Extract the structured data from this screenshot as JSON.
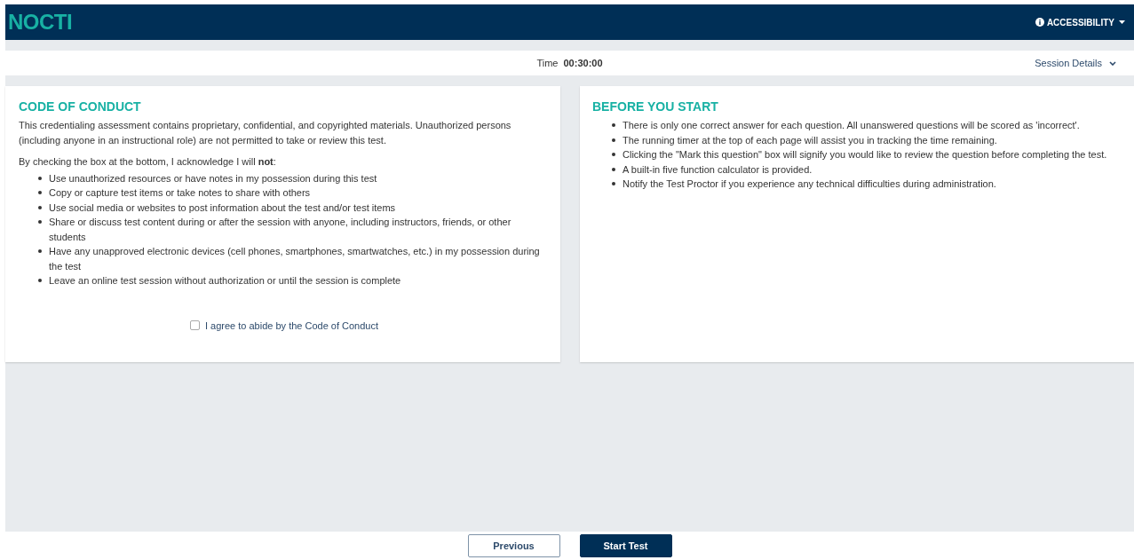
{
  "header": {
    "logo": "NOCTI",
    "accessibility": "ACCESSIBILITY"
  },
  "time_bar": {
    "label": "Time",
    "value": "00:30:00",
    "session_details": "Session Details"
  },
  "code_of_conduct": {
    "title": "CODE OF CONDUCT",
    "intro": "This credentialing assessment contains proprietary, confidential, and copyrighted materials. Unauthorized persons (including anyone in an instructional role) are not permitted to take or review this test.",
    "lead": "By checking the box at the bottom, I acknowledge I will **not**:",
    "items": [
      "Use unauthorized resources or have notes in my possession during this test",
      "Copy or capture test items or take notes to share with others",
      "Use social media or websites to post information about the test and/or test items",
      "Share or discuss test content during or after the session with anyone, including instructors, friends, or other students",
      "Have any unapproved electronic devices (cell phones, smartphones, smartwatches, etc.) in my possession during the test",
      "Leave an online test session without authorization or until the session is complete"
    ],
    "agree": {
      "label": "I agree to abide by the Code of Conduct",
      "checked": false
    }
  },
  "before_you_start": {
    "title": "BEFORE YOU START",
    "items": [
      "There is only one correct answer for each question. All unanswered questions will be scored as 'incorrect'.",
      "The running timer at the top of each page will assist you in tracking the time remaining.",
      "Clicking the \"Mark this question\" box will signify you would like to review the question before completing the test.",
      "A built-in five function calculator is provided.",
      "Notify the Test Proctor if you experience any technical difficulties during administration."
    ]
  },
  "footer": {
    "buttons": [
      {
        "label": "Previous",
        "kind": "secondary"
      },
      {
        "label": "Start Test",
        "kind": "primary"
      }
    ]
  }
}
